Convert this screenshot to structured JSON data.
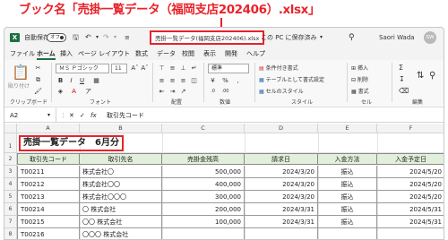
{
  "annotation": {
    "text": "ブック名「売掛一覧データ（福岡支店202406）.xlsx」"
  },
  "titlebar": {
    "autosave_label": "自動保存",
    "autosave_state": "オフ",
    "undo_icon": "undo-icon",
    "redo_icon": "redo-icon",
    "filename": "売掛一覧データ(福岡支店202406).xlsx",
    "save_location": "この PC に保存済み",
    "search_icon": "search-icon",
    "user_name": "Saori Wada",
    "avatar_initials": "SW"
  },
  "menu": [
    "ファイル",
    "ホーム",
    "挿入",
    "ページ レイアウト",
    "数式",
    "データ",
    "校閲",
    "表示",
    "開発",
    "ヘルプ"
  ],
  "ribbon": {
    "paste_label": "貼り付け",
    "font_name": "ＭＳ Ｐゴシック",
    "font_size": "11",
    "number_format": "標準",
    "conditional_format": "条件付き書式",
    "table_format": "テーブルとして書式設定",
    "cell_styles": "セルのスタイル",
    "insert": "挿入",
    "delete": "削除",
    "format": "書式",
    "groups": [
      "クリップボード",
      "フォント",
      "配置",
      "数値",
      "スタイル",
      "セル",
      "編集"
    ]
  },
  "formula_bar": {
    "name_box": "A2",
    "fx": "fx",
    "content": "取引先コード"
  },
  "grid": {
    "columns": [
      "A",
      "B",
      "C",
      "D",
      "E",
      "F"
    ],
    "rows": [
      "1",
      "2",
      "3",
      "4",
      "5",
      "6",
      "7",
      "8"
    ],
    "title": "売掛一覧データ　6月分",
    "headers": [
      "取引先コード",
      "取引先名",
      "売掛金残高",
      "請求日",
      "入金方法",
      "入金予定日"
    ],
    "data": [
      [
        "T00211",
        "株式会社〇",
        "500,000",
        "2024/3/20",
        "振込",
        "2024/5/20"
      ],
      [
        "T00212",
        "株式会社〇〇",
        "400,000",
        "2024/3/20",
        "振込",
        "2024/5/20"
      ],
      [
        "T00213",
        "株式会社〇〇〇",
        "300,000",
        "2024/3/20",
        "振込",
        "2024/5/20"
      ],
      [
        "T00214",
        "〇 株式会社",
        "200,000",
        "2024/3/31",
        "振込",
        "2024/5/31"
      ],
      [
        "T00215",
        "〇〇 株式会社",
        "100,000",
        "2024/3/31",
        "振込",
        "2024/5/31"
      ],
      [
        "T00216",
        "〇〇〇 株式会社",
        "",
        "",
        "",
        ""
      ]
    ]
  }
}
